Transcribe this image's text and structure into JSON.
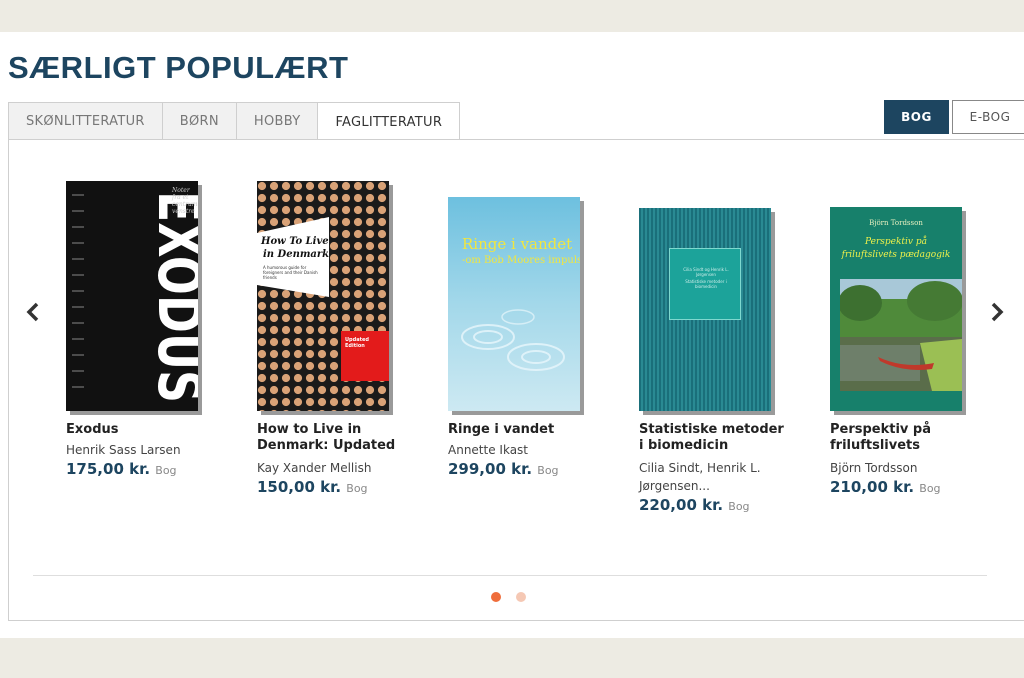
{
  "section_title": "SÆRLIGT POPULÆRT",
  "tabs": [
    {
      "label": "SKØNLITTERATUR"
    },
    {
      "label": "BØRN"
    },
    {
      "label": "HOBBY"
    },
    {
      "label": "FAGLITTERATUR"
    }
  ],
  "format_toggle": {
    "bog": "BOG",
    "ebog": "E-BOG"
  },
  "nav": {
    "prev_icon": "chevron-left-icon",
    "next_icon": "chevron-right-icon"
  },
  "books": [
    {
      "title": "Exodus",
      "author": "Henrik Sass Larsen",
      "price": "175,00 kr.",
      "type": "Bog",
      "cover": {
        "main_text": "EXODUS",
        "side_text": "Noter fra et centrum-venstre"
      }
    },
    {
      "title": "How to Live in Denmark: Updated",
      "author": "Kay Xander Mellish",
      "price": "150,00 kr.",
      "type": "Bog",
      "cover": {
        "title_line1": "How To Live",
        "title_line2": "in Denmark",
        "sub": "A humorous guide for foreigners and their Danish friends",
        "badge": "Updated Edition"
      }
    },
    {
      "title": "Ringe i vandet",
      "author": "Annette Ikast",
      "price": "299,00 kr.",
      "type": "Bog",
      "cover": {
        "title": "Ringe i vandet",
        "sub": "-om Bob Moores impuls"
      }
    },
    {
      "title": "Statistiske metoder i biomedicin",
      "author": "Cilia Sindt, Henrik L. Jørgensen...",
      "price": "220,00 kr.",
      "type": "Bog",
      "cover": {
        "line1": "Cilia Sindt og Henrik L. Jørgensen",
        "line2": "Statistiske metoder i biomedicin"
      }
    },
    {
      "title": "Perspektiv på friluftslivets",
      "author": "Björn Tordsson",
      "price": "210,00 kr.",
      "type": "Bog",
      "cover": {
        "author": "Björn Tordsson",
        "title": "Perspektiv på friluftslivets pædagogik"
      }
    }
  ],
  "pagination": {
    "pages": 2,
    "current": 1
  },
  "colors": {
    "brand": "#1d4560",
    "accent": "#ef6d3b"
  }
}
